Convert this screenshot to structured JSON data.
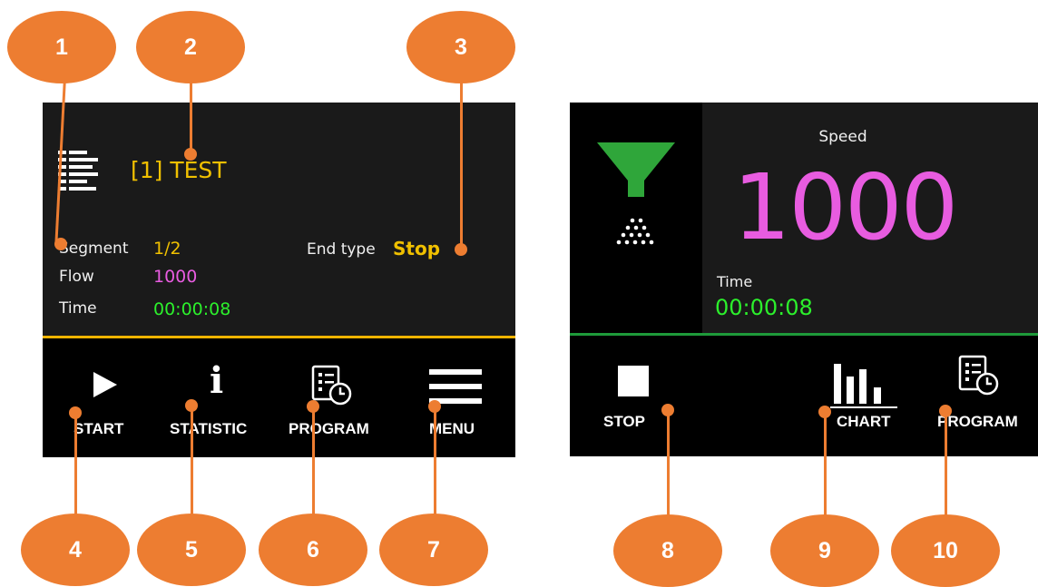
{
  "left_screen": {
    "program_title": "[1] TEST",
    "rows": [
      {
        "label": "Segment",
        "value": "1/2",
        "color": "#f0c000"
      },
      {
        "label": "Flow",
        "value": "1000",
        "color": "#e85ce0"
      },
      {
        "label": "Time",
        "value": "00:00:08",
        "color": "#2cf02c"
      }
    ],
    "end_type_label": "End type",
    "end_type_value": "Stop",
    "accent": "#f0b400",
    "buttons": {
      "start": "START",
      "statistic": "STATISTIC",
      "program": "PROGRAM",
      "menu": "MENU"
    }
  },
  "right_screen": {
    "speed_label": "Speed",
    "speed_value": "1000",
    "time_label": "Time",
    "time_value": "00:00:08",
    "accent": "#1e9a3a",
    "buttons": {
      "stop": "STOP",
      "chart": "CHART",
      "program": "PROGRAM"
    }
  },
  "callouts": [
    "1",
    "2",
    "3",
    "4",
    "5",
    "6",
    "7",
    "8",
    "9",
    "10"
  ],
  "callout_color": "#ed7d31"
}
